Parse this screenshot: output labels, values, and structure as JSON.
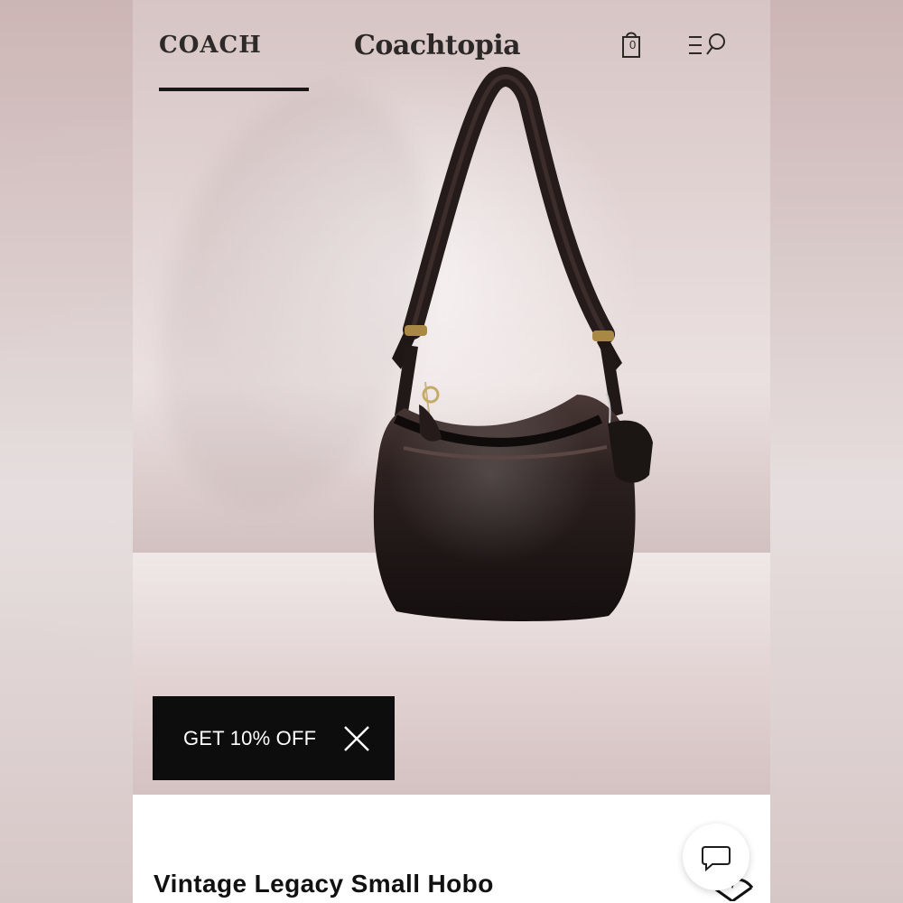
{
  "header": {
    "brand": "COACH",
    "subbrand": "Coachtopia",
    "bag_count": "0",
    "icons": {
      "bag": "shopping-bag-icon",
      "menu": "menu-search-icon"
    }
  },
  "promo": {
    "label": "GET 10% OFF",
    "close_icon": "close-icon"
  },
  "product": {
    "title": "Vintage Legacy Small Hobo"
  },
  "actions": {
    "chat_icon": "chat-icon",
    "favorite_icon": "heart-icon"
  },
  "colors": {
    "background": "#e7dede",
    "promo_bg": "#0e0d0d",
    "text_primary": "#111111"
  }
}
